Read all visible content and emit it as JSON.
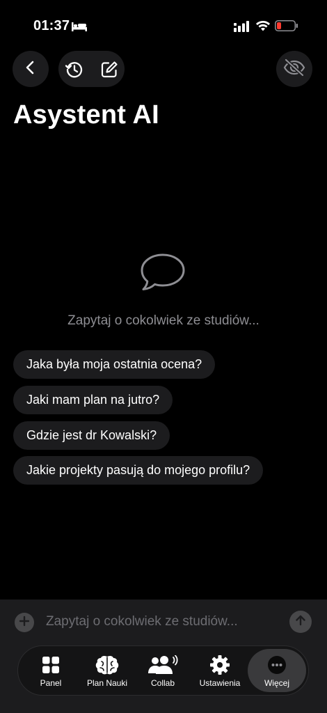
{
  "status_bar": {
    "time": "01:37",
    "icons": [
      "bed-icon",
      "signal-icon",
      "wifi-icon",
      "battery-low-icon"
    ],
    "battery_color": "#ff3b30"
  },
  "header": {
    "title": "Asystent AI",
    "icons": [
      "chevron-left-icon",
      "history-icon",
      "compose-icon",
      "eye-slash-icon"
    ]
  },
  "empty_state": {
    "icon": "chat-bubble-icon",
    "text": "Zapytaj o cokolwiek ze studiów..."
  },
  "suggestions": [
    "Jaka była moja ostatnia ocena?",
    "Jaki mam plan na jutro?",
    "Gdzie jest dr Kowalski?",
    "Jakie projekty pasują do mojego profilu?"
  ],
  "input": {
    "placeholder": "Zapytaj o cokolwiek ze studiów...",
    "icons": [
      "plus-icon",
      "send-arrow-icon"
    ]
  },
  "tabbar": {
    "items": [
      {
        "label": "Panel",
        "icon": "grid-icon"
      },
      {
        "label": "Plan Nauki",
        "icon": "brain-icon"
      },
      {
        "label": "Collab",
        "icon": "people-icon"
      },
      {
        "label": "Ustawienia",
        "icon": "gear-icon"
      },
      {
        "label": "Więcej",
        "icon": "more-icon"
      }
    ],
    "active": "Więcej"
  },
  "colors": {
    "background": "#000000",
    "surface": "#1c1c1e",
    "muted_text": "#8e8e93",
    "active_tab": "#3a3a3c"
  }
}
